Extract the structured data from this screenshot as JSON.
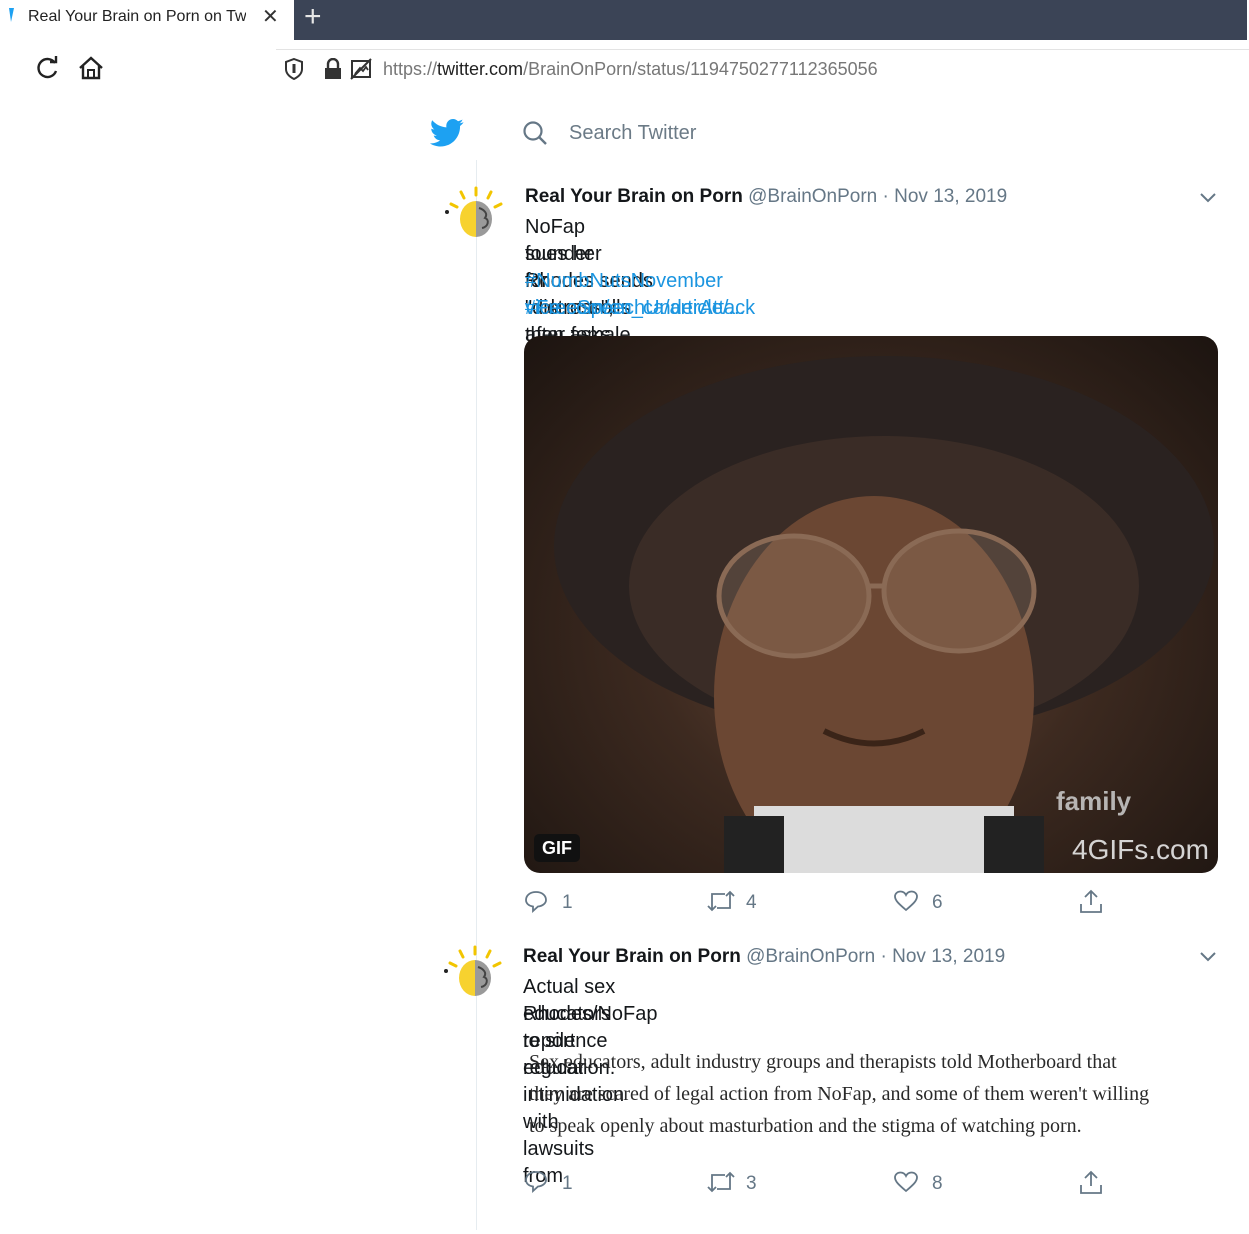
{
  "browser": {
    "tab_title": "Real Your Brain on Porn on Tw",
    "url_prefix": "https://",
    "url_domain": "twitter.com",
    "url_path": "/BrainOnPorn/status/1194750277112365056"
  },
  "twitter": {
    "search_placeholder": "Search Twitter"
  },
  "tweets": [
    {
      "name": "Real Your Brain on Porn",
      "handle": "@BrainOnPorn",
      "sep": "·",
      "date": "Nov 13, 2019",
      "text_line1": "NoFap founder Rhodes sends violent trolls after female neuroscientist, then",
      "text_line2": "sues her for \"distress\", then asks for money to sue the porn industry.",
      "hashtags": "#NumbNutsNovember #FreeSpeechUnderAttack",
      "link": "vice.com/en_ca/article/...",
      "media_badge": "GIF",
      "watermark1": "family",
      "watermark2": "4GIFs.com",
      "replies": "1",
      "retweets": "4",
      "likes": "6"
    },
    {
      "name": "Real Your Brain on Porn",
      "handle": "@BrainOnPorn",
      "sep": "·",
      "date": "Nov 13, 2019",
      "text_line1": "Actual sex educators report regular intimidation with lawsuits from",
      "text_line2": "Rhodes/NoFap to silence education.",
      "quote_line1": "Sex educators, adult industry groups and therapists told Motherboard that",
      "quote_line2": "they are scared of legal action from NoFap, and some of them weren't willing",
      "quote_line3": "to speak openly about masturbation and the stigma of watching porn.",
      "replies": "1",
      "retweets": "3",
      "likes": "8"
    }
  ]
}
